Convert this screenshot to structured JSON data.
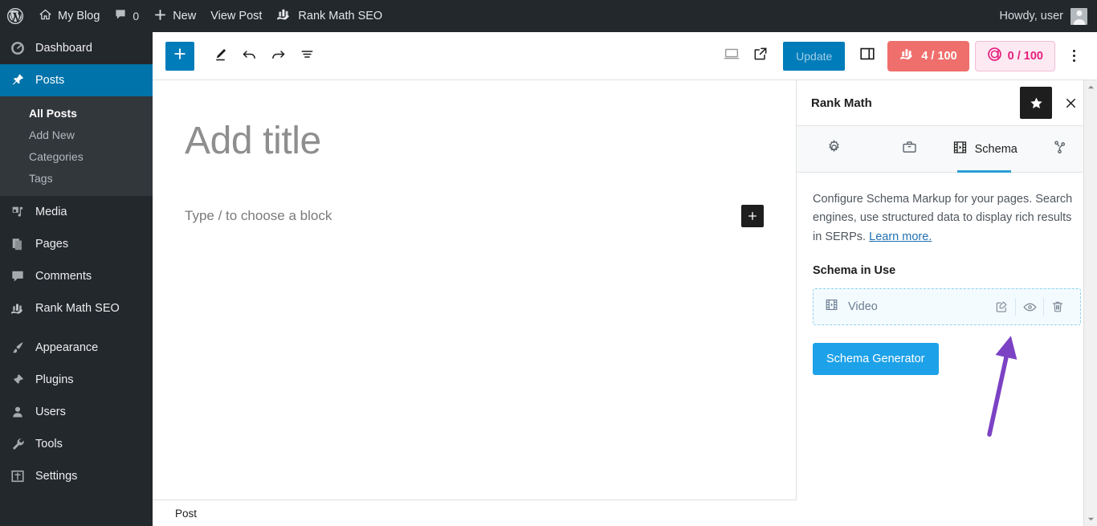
{
  "adminbar": {
    "logo_icon": "wordpress-logo-icon",
    "site_icon": "home-icon",
    "site_name": "My Blog",
    "comments_icon": "comment-bubble-icon",
    "comments_count": "0",
    "new_icon": "plus-icon",
    "new_label": "New",
    "view_post_label": "View Post",
    "rankmath_icon": "rank-math-logo-icon",
    "rankmath_label": "Rank Math SEO",
    "howdy": "Howdy, user",
    "avatar_icon": "avatar-icon"
  },
  "sidebar": {
    "items": [
      {
        "label": "Dashboard",
        "icon": "dashboard-gauge-icon",
        "active": false
      },
      {
        "label": "Posts",
        "icon": "pin-icon",
        "active": true
      },
      {
        "label": "Media",
        "icon": "media-music-icon",
        "active": false
      },
      {
        "label": "Pages",
        "icon": "pages-icon",
        "active": false
      },
      {
        "label": "Comments",
        "icon": "comment-bubble-icon",
        "active": false
      },
      {
        "label": "Rank Math SEO",
        "icon": "rank-math-logo-icon",
        "active": false
      },
      {
        "label": "Appearance",
        "icon": "paintbrush-icon",
        "active": false
      },
      {
        "label": "Plugins",
        "icon": "plug-icon",
        "active": false
      },
      {
        "label": "Users",
        "icon": "user-icon",
        "active": false
      },
      {
        "label": "Tools",
        "icon": "wrench-icon",
        "active": false
      },
      {
        "label": "Settings",
        "icon": "settings-sliders-icon",
        "active": false
      }
    ],
    "submenu": [
      {
        "label": "All Posts",
        "current": true
      },
      {
        "label": "Add New",
        "current": false
      },
      {
        "label": "Categories",
        "current": false
      },
      {
        "label": "Tags",
        "current": false
      }
    ]
  },
  "toolbar": {
    "add_block_icon": "plus-icon",
    "tools_icon": "pencil-edit-icon",
    "undo_icon": "undo-arrow-icon",
    "redo_icon": "redo-arrow-icon",
    "list_view_icon": "list-view-icon",
    "preview_icon": "desktop-preview-icon",
    "view_external_icon": "external-link-icon",
    "update_label": "Update",
    "settings_sidebar_icon": "sidebar-panel-icon",
    "seo_score_icon": "rank-math-logo-icon",
    "seo_score": "4 / 100",
    "ai_score_icon": "content-ai-icon",
    "ai_score": "0 / 100",
    "options_icon": "kebab-menu-icon"
  },
  "canvas": {
    "title_placeholder": "Add title",
    "block_placeholder": "Type / to choose a block",
    "inserter_icon": "plus-icon",
    "status_label": "Post"
  },
  "rankmath": {
    "panel_title": "Rank Math",
    "star_icon": "star-icon",
    "close_icon": "close-x-icon",
    "tabs": [
      {
        "label": "",
        "icon": "gear-icon",
        "active": false
      },
      {
        "label": "",
        "icon": "briefcase-icon",
        "active": false
      },
      {
        "label": "Schema",
        "icon": "film-strip-icon",
        "active": true
      },
      {
        "label": "",
        "icon": "share-nodes-icon",
        "active": false
      }
    ],
    "description": "Configure Schema Markup for your pages. Search engines, use structured data to display rich results in SERPs.",
    "learn_more": "Learn more.",
    "section_title": "Schema in Use",
    "schema_items": [
      {
        "name": "Video",
        "type_icon": "film-strip-icon",
        "edit_icon": "pencil-square-icon",
        "preview_icon": "eye-icon",
        "delete_icon": "trash-icon"
      }
    ],
    "generator_button": "Schema Generator"
  },
  "scrollbar": {
    "up_icon": "scroll-up-arrow-icon",
    "down_icon": "scroll-down-arrow-icon"
  },
  "annotation": {
    "arrow_color": "#7b42c4",
    "points_to": "eye-icon"
  },
  "colors": {
    "admin_dark": "#23282d",
    "admin_blue": "#0073aa",
    "wp_blue": "#007cba",
    "seo_red": "#ef6f6c",
    "ai_pink": "#e5207e",
    "rm_blue": "#1da1e8",
    "annotation_purple": "#7b42c4"
  }
}
